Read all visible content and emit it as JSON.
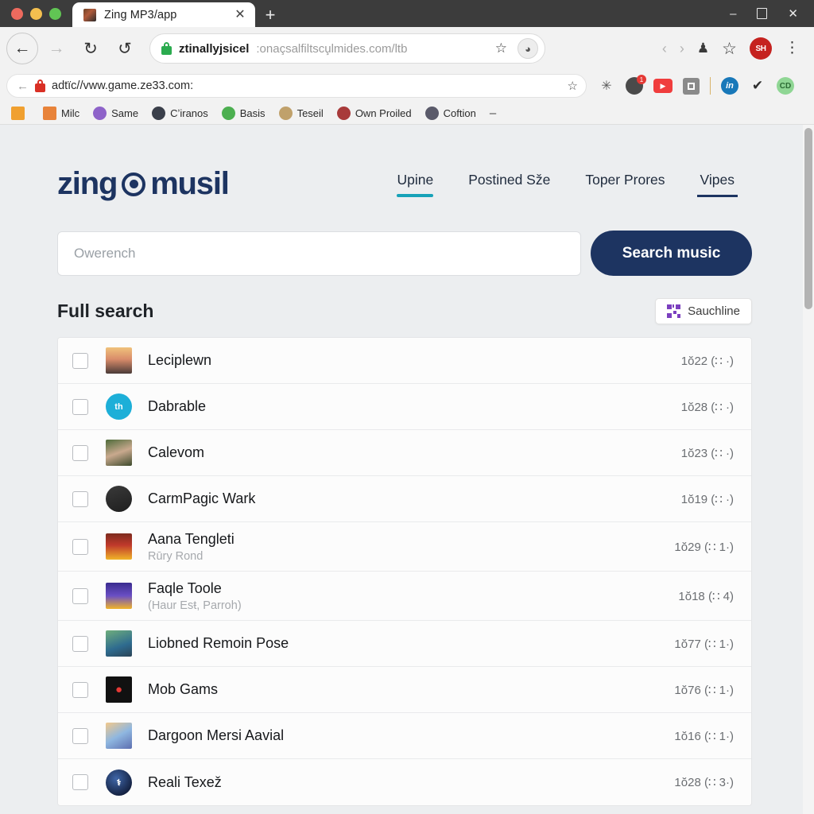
{
  "browser": {
    "tab": {
      "title": "Zing MP3/app",
      "favicon": "album-art-favicon",
      "close": "✕"
    },
    "new_tab": "+",
    "window": {
      "minimize": "–",
      "maximize": "□",
      "close": "✕"
    },
    "toolbar": {
      "back": "←",
      "forward": "→",
      "reload": "↻",
      "reload2": "↺",
      "url_strong": "ztinallyjsicel",
      "url_dim": ":onaçsalfiltscu̧lmides.com/ltb",
      "star": "☆",
      "profile": "◕",
      "prev_chevron": "‹",
      "next_chevron": "›",
      "lock_icon": "lock-icon",
      "extensions_icon": "♟",
      "bookmark_star": "☆",
      "account_initials": "SH",
      "menu": "⋮"
    },
    "toolbar2": {
      "back": "←",
      "url": "adtïc//vww.game.ze33.com:",
      "star": "☆",
      "extensions": [
        {
          "name": "sparkle-extension-icon",
          "glyph": "✳"
        },
        {
          "name": "notification-extension-icon",
          "glyph": "",
          "badge": "1"
        },
        {
          "name": "youtube-extension-icon",
          "glyph": "▶"
        },
        {
          "name": "screenshot-extension-icon",
          "glyph": ""
        },
        {
          "name": "linkedin-extension-icon",
          "glyph": "in"
        },
        {
          "name": "check-extension-icon",
          "glyph": "✔"
        },
        {
          "name": "cd-extension-icon",
          "glyph": "CD"
        }
      ]
    },
    "bookmarks": [
      {
        "label": "",
        "icon": "windows-bookmark-icon",
        "color": "#f0a030"
      },
      {
        "label": "Milc",
        "icon": "orange-doc-bookmark-icon",
        "color": "#e8833a"
      },
      {
        "label": "Same",
        "icon": "purple-avatar-bookmark-icon",
        "color": "#8e63c9"
      },
      {
        "label": "Cʼiranos",
        "icon": "dark-avatar-bookmark-icon",
        "color": "#3a3f4a"
      },
      {
        "label": "Basis",
        "icon": "green-avatar-bookmark-icon",
        "color": "#4caf50"
      },
      {
        "label": "Teseil",
        "icon": "tan-avatar-bookmark-icon",
        "color": "#c0a16b"
      },
      {
        "label": "Own Proiled",
        "icon": "red-avatar-bookmark-icon",
        "color": "#a83a3a"
      },
      {
        "label": "Coftion",
        "icon": "portrait-bookmark-icon",
        "color": "#5a5a6a"
      }
    ],
    "bookmarks_overflow": "–"
  },
  "site": {
    "logo": {
      "text_left": "zing",
      "text_right": "musil",
      "mark": "target-logo-icon"
    },
    "nav": [
      {
        "label": "Upine",
        "state": "active-teal"
      },
      {
        "label": "Postined Sže",
        "state": ""
      },
      {
        "label": "Toper Prores",
        "state": ""
      },
      {
        "label": "Vipes",
        "state": "active-dark"
      }
    ],
    "search": {
      "placeholder": "Owerench",
      "value": "",
      "button_label": "Search music"
    },
    "results_header": {
      "title": "Full search",
      "sauchline_label": "Sauchline",
      "sauchline_icon": "qr-code-icon"
    },
    "rows": [
      {
        "title": "Leciplewn",
        "subtitle": "",
        "meta": "1ŏ22 (∷ ·)",
        "thumb": "t-landscape",
        "shape": "square",
        "badge": ""
      },
      {
        "title": "Dabrable",
        "subtitle": "",
        "meta": "1ŏ28 (∷ ·)",
        "thumb": "t-cyan",
        "shape": "circle",
        "badge": "th"
      },
      {
        "title": "Calevom",
        "subtitle": "",
        "meta": "1ŏ23 (∷ ·)",
        "thumb": "t-portrait",
        "shape": "square",
        "badge": ""
      },
      {
        "title": "CarmPagic Wark",
        "subtitle": "",
        "meta": "1ŏ19 (∷ ·)",
        "thumb": "t-dark-av",
        "shape": "circle",
        "badge": ""
      },
      {
        "title": "Αana Tengleti",
        "subtitle": "Rūry Rond",
        "meta": "1ŏ29 (∷ 1·)",
        "thumb": "t-poster1",
        "shape": "square",
        "badge": ""
      },
      {
        "title": "Faqle Toole",
        "subtitle": "(Haur Esŧ, Parroh)",
        "meta": "1ŏ18 (∷ 4)",
        "thumb": "t-poster2",
        "shape": "square",
        "badge": ""
      },
      {
        "title": "Liobned Remoin Pose",
        "subtitle": "",
        "meta": "1ŏ77 (∷ 1·)",
        "thumb": "t-family",
        "shape": "square",
        "badge": ""
      },
      {
        "title": "Mob Gams",
        "subtitle": "",
        "meta": "1ŏ76 (∷ 1·)",
        "thumb": "t-black",
        "shape": "square",
        "badge": "●"
      },
      {
        "title": "Dargoon Mersi Aavial",
        "subtitle": "",
        "meta": "1ŏ16 (∷ 1·)",
        "thumb": "t-anime",
        "shape": "square",
        "badge": ""
      },
      {
        "title": "Reali Texež",
        "subtitle": "",
        "meta": "1ŏ28 (∷ 3·)",
        "thumb": "t-navy",
        "shape": "circle",
        "badge": "⚕"
      }
    ]
  },
  "colors": {
    "brand_navy": "#1d3461",
    "accent_teal": "#17a2b8",
    "page_bg": "#eceef0",
    "purple": "#7b3fbf"
  }
}
